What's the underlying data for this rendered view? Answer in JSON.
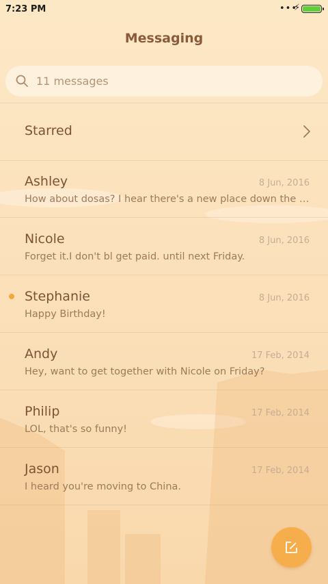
{
  "status_bar": {
    "time": "7:23 PM",
    "dots": "•••",
    "bolt": "⚡"
  },
  "header": {
    "title": "Messaging"
  },
  "search": {
    "placeholder": "11 messages"
  },
  "starred": {
    "label": "Starred"
  },
  "conversations": [
    {
      "name": "Ashley",
      "date": "8 Jun, 2016",
      "preview": "How about dosas? I hear there's a new place down the st...",
      "unread": false
    },
    {
      "name": "Nicole",
      "date": "8 Jun, 2016",
      "preview": "Forget it.I don't bl get paid. until next Friday.",
      "unread": false
    },
    {
      "name": "Stephanie",
      "date": "8 Jun, 2016",
      "preview": "Happy Birthday!",
      "unread": true
    },
    {
      "name": "Andy",
      "date": "17 Feb, 2014",
      "preview": "Hey, want to get together with Nicole on Friday?",
      "unread": false
    },
    {
      "name": "Philip",
      "date": "17 Feb, 2014",
      "preview": "LOL, that's so funny!",
      "unread": false
    },
    {
      "name": "Jason",
      "date": "17 Feb, 2014",
      "preview": "I heard you're moving to China.",
      "unread": false
    }
  ],
  "colors": {
    "accent": "#f6ae4c",
    "unread_dot": "#f0a93a",
    "battery": "#5fcf3e"
  }
}
